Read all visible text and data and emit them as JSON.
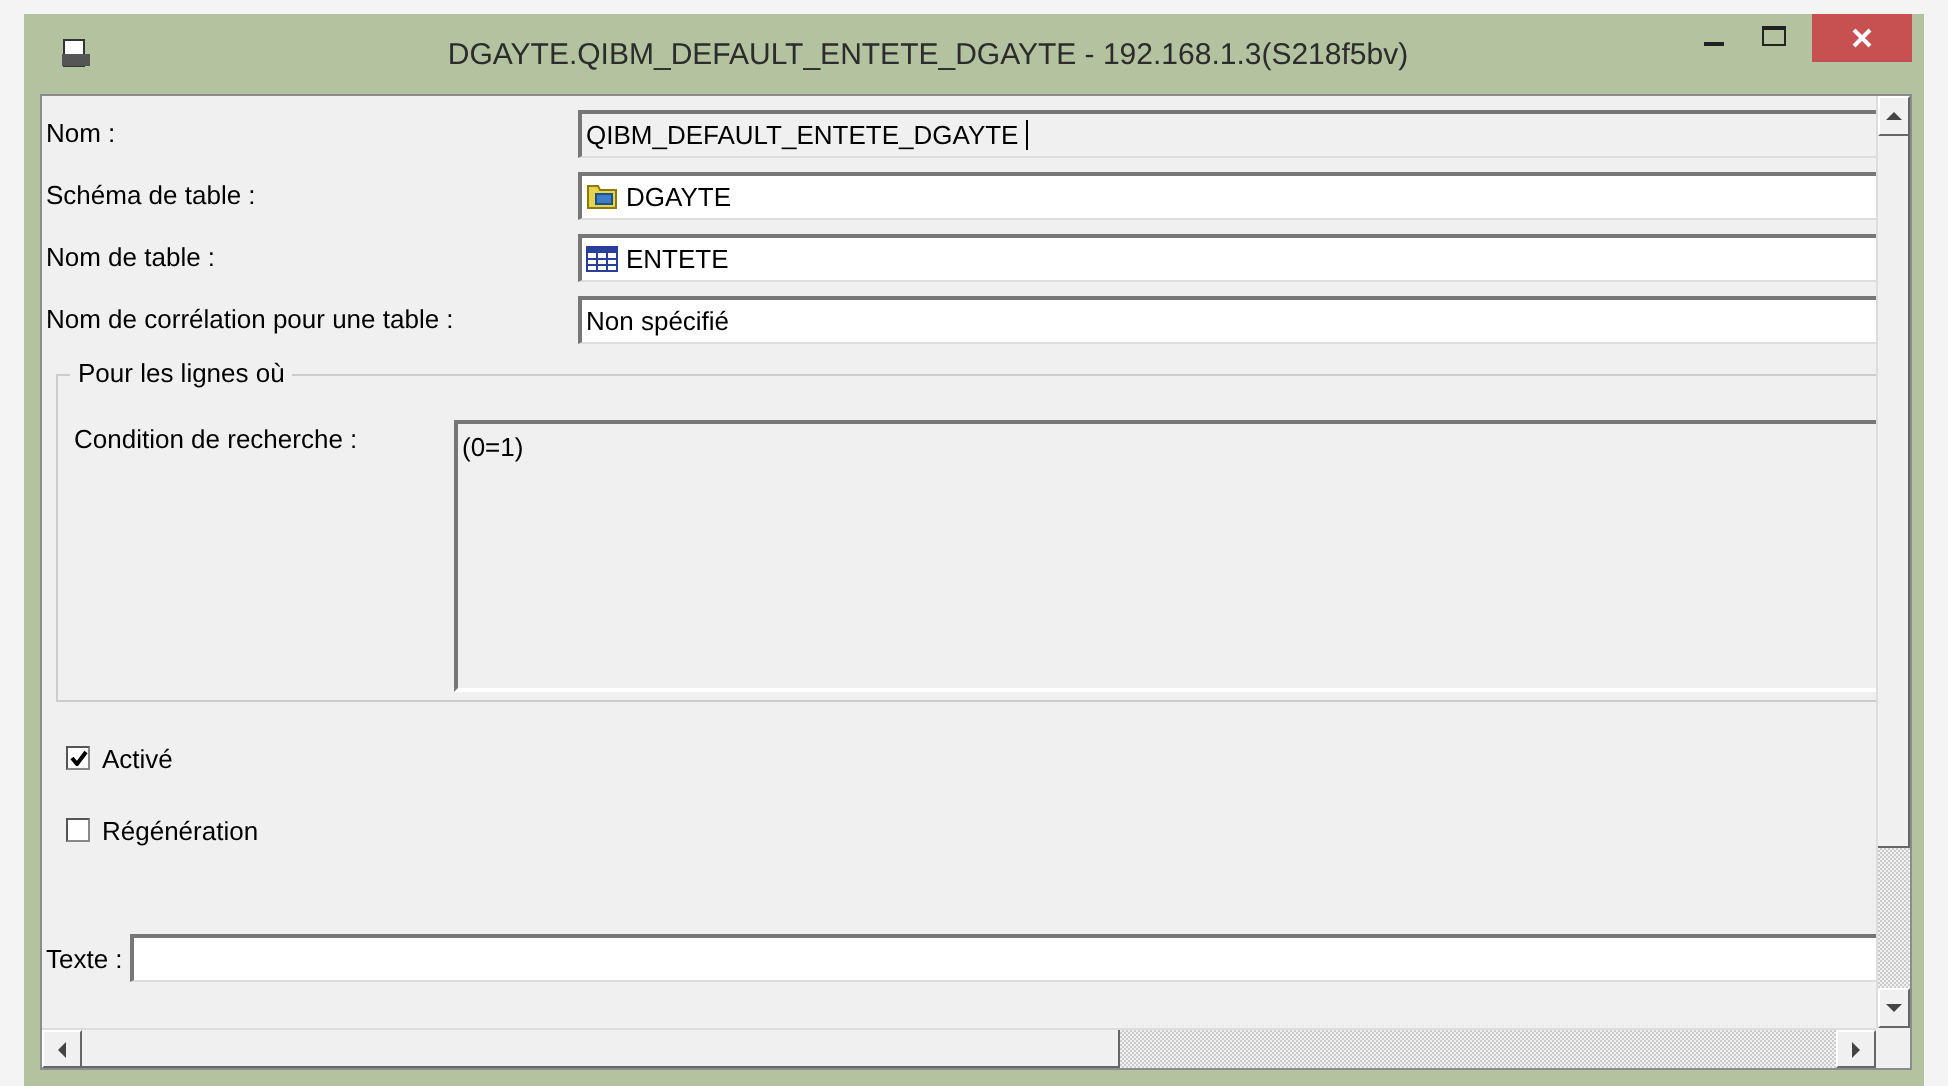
{
  "window": {
    "title": "DGAYTE.QIBM_DEFAULT_ENTETE_DGAYTE - 192.168.1.3(S218f5bv)"
  },
  "fields": [
    {
      "label": "Nom :",
      "value": "QIBM_DEFAULT_ENTETE_DGAYTE",
      "kind": "readonly"
    },
    {
      "label": "Schéma de table :",
      "value": "DGAYTE",
      "kind": "schema"
    },
    {
      "label": "Nom de table :",
      "value": "ENTETE",
      "kind": "table"
    },
    {
      "label": "Nom de corrélation pour une table :",
      "value": "Non spécifié",
      "kind": "text"
    }
  ],
  "group": {
    "title": "Pour les lignes où",
    "condition_label": "Condition de recherche :",
    "condition_value": "(0=1)"
  },
  "checkboxes": [
    {
      "label": "Activé",
      "checked": true
    },
    {
      "label": "Régénération",
      "checked": false
    }
  ],
  "text_field": {
    "label": "Texte :"
  }
}
